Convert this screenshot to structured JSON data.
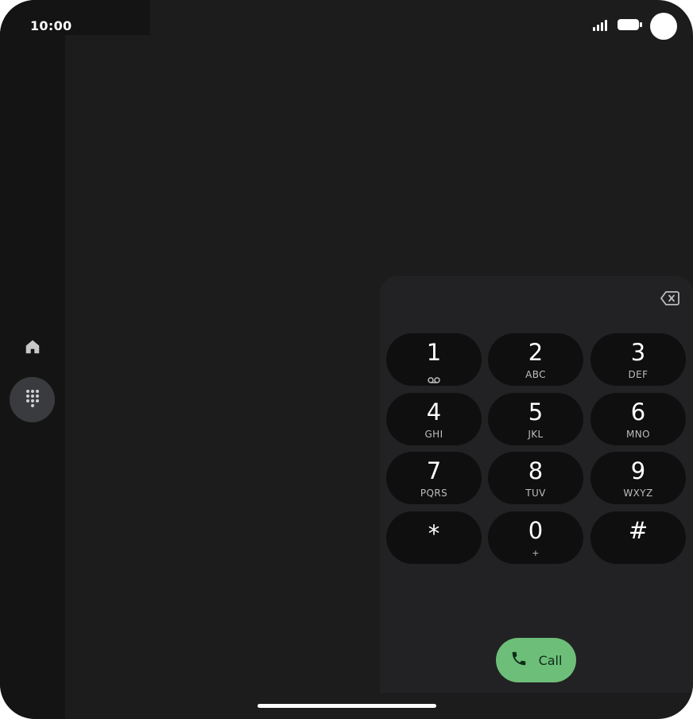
{
  "status_bar": {
    "time": "10:00",
    "icons": [
      "signal-icon",
      "battery-icon",
      "camera-cutout"
    ]
  },
  "nav_rail": {
    "items": [
      {
        "icon": "home-icon",
        "selected": false
      },
      {
        "icon": "dialpad-icon",
        "selected": true
      }
    ]
  },
  "dialpad": {
    "backspace_icon": "backspace-icon",
    "keys": [
      {
        "digit": "1",
        "letters": "",
        "icon": "voicemail-icon"
      },
      {
        "digit": "2",
        "letters": "ABC"
      },
      {
        "digit": "3",
        "letters": "DEF"
      },
      {
        "digit": "4",
        "letters": "GHI"
      },
      {
        "digit": "5",
        "letters": "JKL"
      },
      {
        "digit": "6",
        "letters": "MNO"
      },
      {
        "digit": "7",
        "letters": "PQRS"
      },
      {
        "digit": "8",
        "letters": "TUV"
      },
      {
        "digit": "9",
        "letters": "WXYZ"
      },
      {
        "digit": "*",
        "letters": ""
      },
      {
        "digit": "0",
        "letters": "+"
      },
      {
        "digit": "#",
        "letters": ""
      }
    ],
    "call_button": {
      "label": "Call",
      "icon": "phone-icon"
    }
  },
  "colors": {
    "background": "#1c1c1d",
    "rail": "#141414",
    "panel": "#222224",
    "key": "#0f0f10",
    "call_accent": "#6dbe79"
  }
}
